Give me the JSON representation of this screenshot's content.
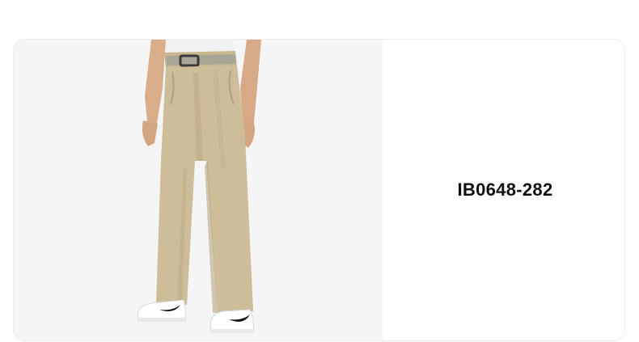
{
  "product": {
    "style_code": "IB0648-282",
    "image": {
      "subject": "khaki-pants-image",
      "colors": {
        "background": "#f5f5f5",
        "pants": "#cdbd98",
        "shirt": "#f2f2f2",
        "belt": "#a9a799",
        "shoe": "#ffffff",
        "swoosh": "#111111"
      }
    }
  }
}
